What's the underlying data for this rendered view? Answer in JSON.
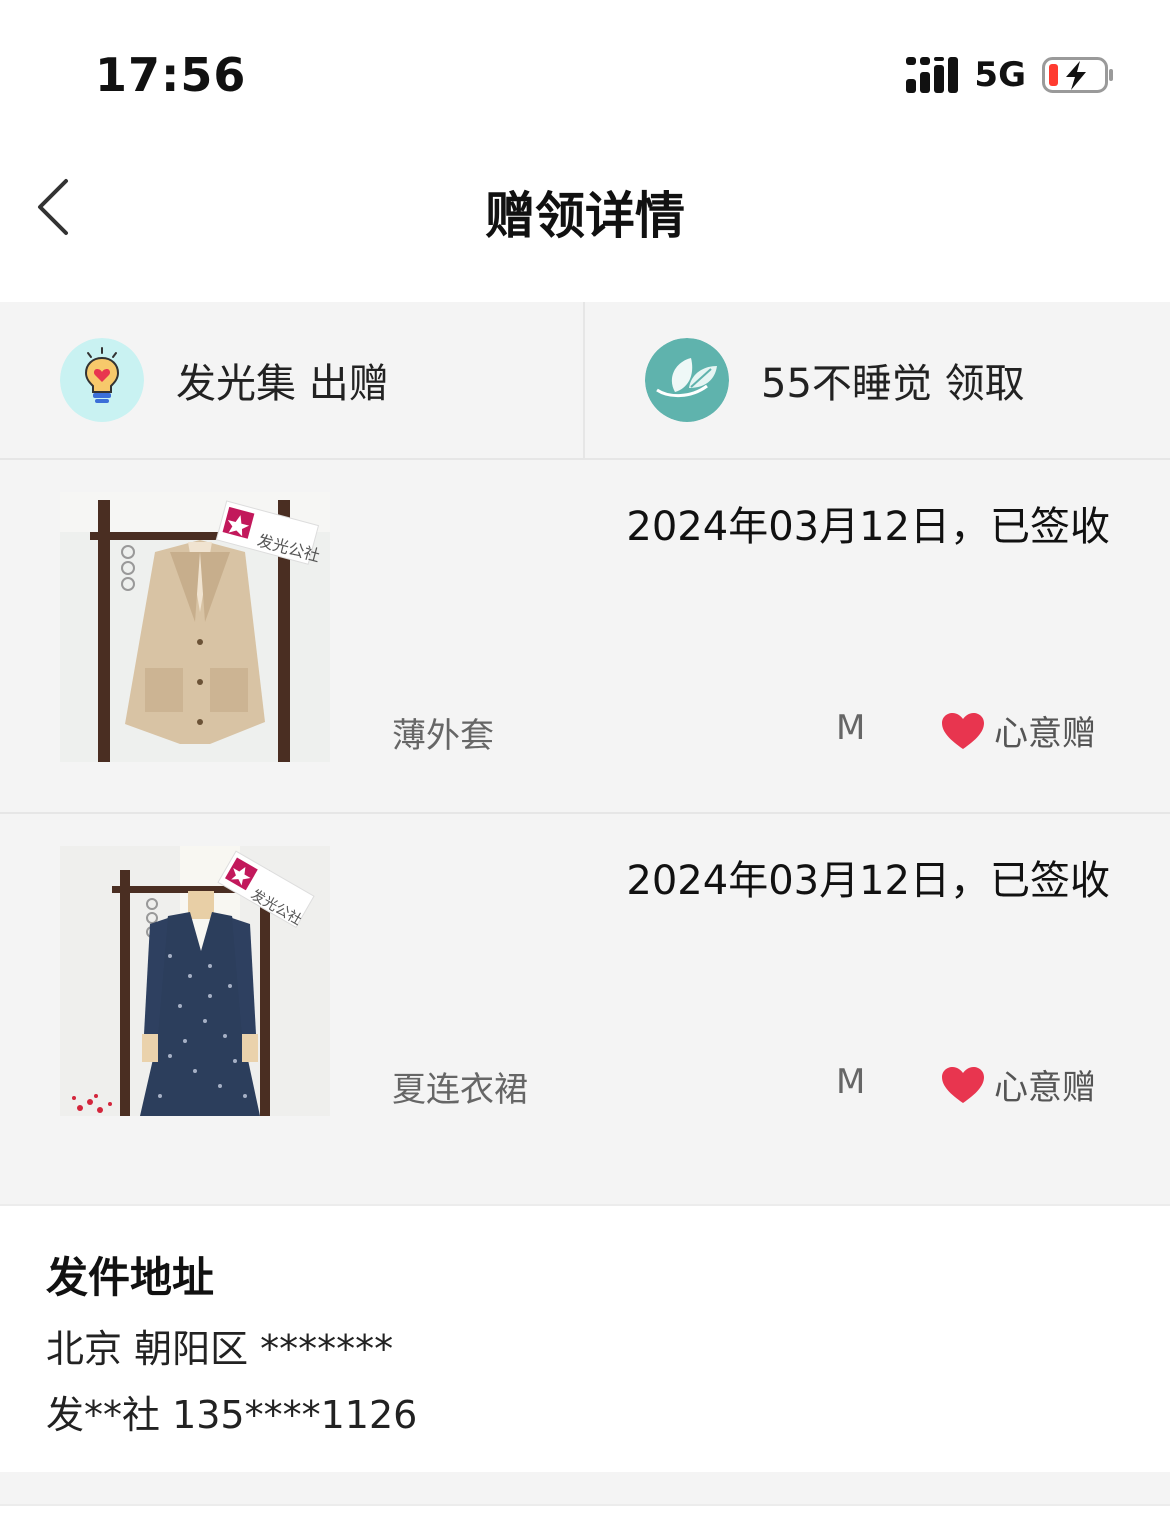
{
  "status_bar": {
    "time": "17:56",
    "network": "5G",
    "icons": [
      "signal-icon",
      "battery-charging-icon"
    ]
  },
  "nav": {
    "title": "赠领详情",
    "back_icon": "chevron-left-icon"
  },
  "parties": {
    "donor": {
      "label": "发光集 出赠",
      "avatar_icon": "lightbulb-heart-icon"
    },
    "receiver": {
      "label": "55不睡觉 领取",
      "avatar_icon": "leaf-icon"
    }
  },
  "items": [
    {
      "date_status": "2024年03月12日，已签收",
      "name": "薄外套",
      "size": "M",
      "tag": "心意赠",
      "image": "beige-jacket-photo",
      "watermark": "发光公社"
    },
    {
      "date_status": "2024年03月12日，已签收",
      "name": "夏连衣裙",
      "size": "M",
      "tag": "心意赠",
      "image": "navy-floral-dress-photo",
      "watermark": "发光公社"
    }
  ],
  "address": {
    "title": "发件地址",
    "line1": "北京 朝阳区 *******",
    "line2": "发**社 135****1126"
  },
  "colors": {
    "heart": "#e8354f",
    "battery_low": "#ff3b30",
    "receiver_avatar": "#5fb3ad",
    "donor_avatar": "#c9f2f2"
  }
}
